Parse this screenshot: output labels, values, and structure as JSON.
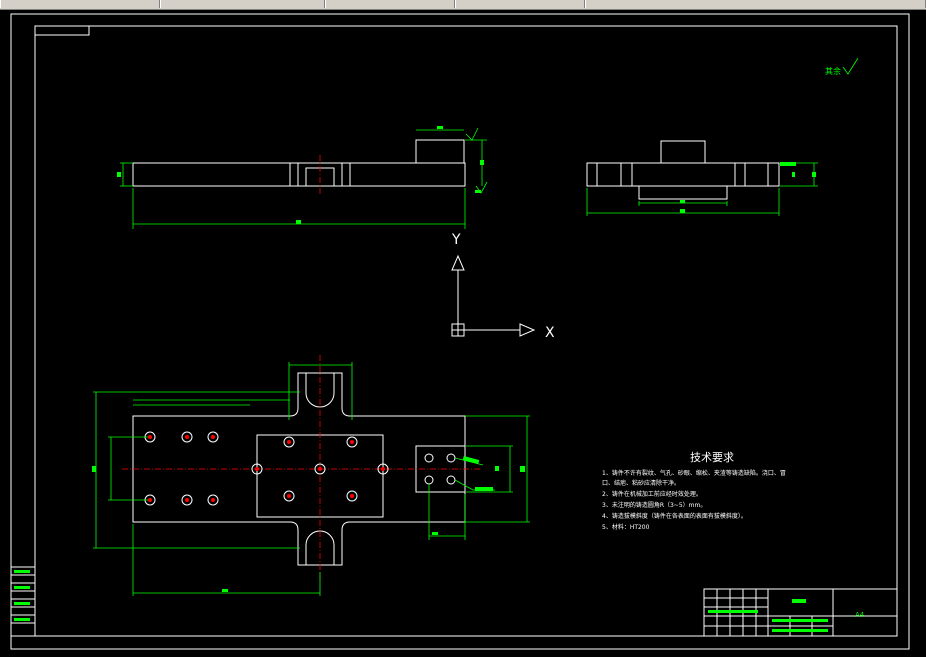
{
  "tabs": [
    {
      "label": "",
      "active": true
    },
    {
      "label": "",
      "active": false
    },
    {
      "label": "",
      "active": false
    },
    {
      "label": "",
      "active": false
    },
    {
      "label": "",
      "active": false
    }
  ],
  "drawing": {
    "roughness_note": "其余",
    "ucs": {
      "x_label": "X",
      "y_label": "Y"
    },
    "tech_requirements": {
      "title": "技术要求",
      "items": [
        "1、铸件不许有裂纹、气孔、砂眼、缩松、夹渣等铸造缺陷。浇口、冒",
        "口、结疤、粘砂应清除干净。",
        "2、铸件在机械加工前应经时效处理。",
        "3、未注明的铸造圆角R（3~5）mm。",
        "4、铸造拔模斜度（铸件在各表面的表面有拔模斜度）。",
        "5、材料：HT200"
      ]
    },
    "title_block": {
      "material": "HT200",
      "sheet": "A4"
    },
    "colors": {
      "outline": "#ffffff",
      "dimension": "#00ff00",
      "centerline": "#ff0000",
      "background": "#000000"
    }
  }
}
